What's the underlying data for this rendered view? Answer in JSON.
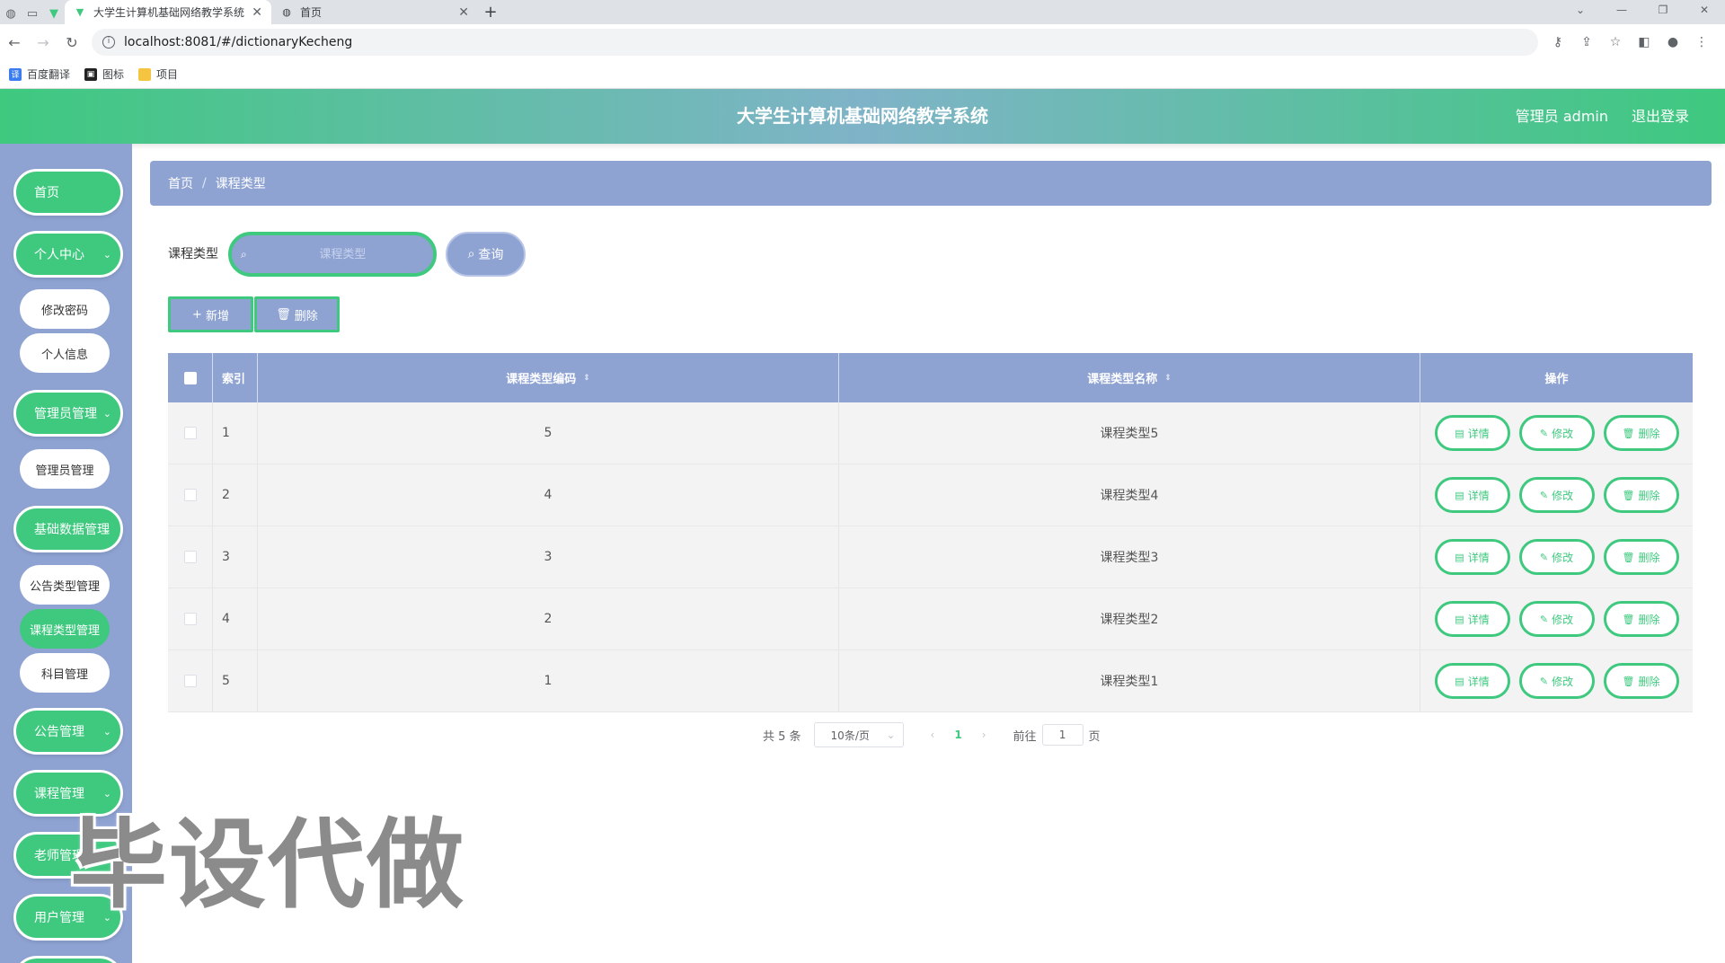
{
  "browser": {
    "tabs": [
      {
        "title": "大学生计算机基础网络教学系统",
        "active": true
      },
      {
        "title": "首页",
        "active": false
      }
    ],
    "url": "localhost:8081/#/dictionaryKecheng",
    "bookmarks": [
      "百度翻译",
      "图标",
      "项目"
    ]
  },
  "header": {
    "title": "大学生计算机基础网络教学系统",
    "user": "管理员 admin",
    "logout": "退出登录"
  },
  "sidebar": {
    "home": "首页",
    "personal": "个人中心",
    "change_password": "修改密码",
    "personal_info": "个人信息",
    "admin_mgmt": "管理员管理",
    "admin_mgmt_sub": "管理员管理",
    "basic_data": "基础数据管理",
    "notice_type": "公告类型管理",
    "course_type": "课程类型管理",
    "subject_mgmt": "科目管理",
    "notice_mgmt": "公告管理",
    "course_mgmt": "课程管理",
    "teacher_mgmt": "老师管理",
    "user_mgmt": "用户管理"
  },
  "breadcrumb": {
    "home": "首页",
    "sep": "/",
    "current": "课程类型"
  },
  "search": {
    "label": "课程类型",
    "placeholder": "课程类型",
    "query": "查询"
  },
  "actions": {
    "add": "新增",
    "delete": "删除"
  },
  "table": {
    "headers": {
      "index": "索引",
      "code": "课程类型编码",
      "name": "课程类型名称",
      "op": "操作"
    },
    "rows": [
      {
        "index": "1",
        "code": "5",
        "name": "课程类型5"
      },
      {
        "index": "2",
        "code": "4",
        "name": "课程类型4"
      },
      {
        "index": "3",
        "code": "3",
        "name": "课程类型3"
      },
      {
        "index": "4",
        "code": "2",
        "name": "课程类型2"
      },
      {
        "index": "5",
        "code": "1",
        "name": "课程类型1"
      }
    ],
    "op_labels": {
      "detail": "详情",
      "edit": "修改",
      "delete": "删除"
    }
  },
  "pagination": {
    "total": "共 5 条",
    "page_size": "10条/页",
    "current_page": "1",
    "goto_prefix": "前往",
    "goto_value": "1",
    "goto_suffix": "页"
  },
  "watermark": "毕设代做",
  "colors": {
    "accent_green": "#3ec97f",
    "accent_blue": "#8fa3d3"
  }
}
